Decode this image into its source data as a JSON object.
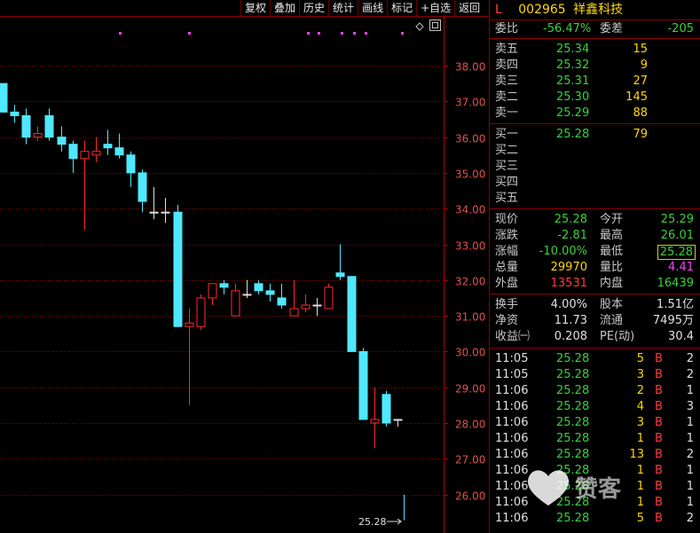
{
  "toolbar": {
    "items": [
      "复权",
      "叠加",
      "历史",
      "统计",
      "画线",
      "标记",
      "+自选",
      "返回"
    ]
  },
  "chart_data": {
    "type": "candlestick",
    "y_ticks": [
      "38.00",
      "37.00",
      "36.00",
      "35.00",
      "34.00",
      "33.00",
      "32.00",
      "31.00",
      "30.00",
      "29.00",
      "28.00",
      "27.00",
      "26.00"
    ],
    "ylim": [
      25.0,
      39.0
    ],
    "price_tag": "25.28",
    "colors": {
      "up": "#ff2a2a",
      "down": "#4fe8ff",
      "grid": "#8b0000",
      "axis": "#b00000",
      "tick_label": "#e05050",
      "flat": "#e0e0e0",
      "marker": "#ff40ff"
    },
    "candles": [
      {
        "o": 37.5,
        "h": 37.5,
        "l": 36.7,
        "c": 36.7
      },
      {
        "o": 36.7,
        "h": 36.9,
        "l": 36.4,
        "c": 36.6
      },
      {
        "o": 36.6,
        "h": 36.8,
        "l": 35.8,
        "c": 36.0
      },
      {
        "o": 36.0,
        "h": 36.3,
        "l": 35.9,
        "c": 36.1
      },
      {
        "o": 36.6,
        "h": 36.8,
        "l": 35.9,
        "c": 36.0
      },
      {
        "o": 36.0,
        "h": 36.3,
        "l": 35.6,
        "c": 35.8
      },
      {
        "o": 35.8,
        "h": 35.9,
        "l": 35.0,
        "c": 35.4
      },
      {
        "o": 35.4,
        "h": 35.9,
        "l": 33.4,
        "c": 35.6
      },
      {
        "o": 35.5,
        "h": 36.0,
        "l": 35.3,
        "c": 35.6
      },
      {
        "o": 35.8,
        "h": 36.2,
        "l": 35.5,
        "c": 35.7
      },
      {
        "o": 35.7,
        "h": 36.1,
        "l": 35.4,
        "c": 35.5
      },
      {
        "o": 35.5,
        "h": 35.6,
        "l": 34.6,
        "c": 35.0
      },
      {
        "o": 35.0,
        "h": 35.1,
        "l": 33.9,
        "c": 34.2
      },
      {
        "o": 33.9,
        "h": 34.6,
        "l": 33.7,
        "c": 33.9
      },
      {
        "o": 33.9,
        "h": 34.3,
        "l": 33.6,
        "c": 33.9
      },
      {
        "o": 33.9,
        "h": 34.1,
        "l": 30.7,
        "c": 30.7
      },
      {
        "o": 30.7,
        "h": 31.2,
        "l": 28.5,
        "c": 30.8
      },
      {
        "o": 30.7,
        "h": 31.6,
        "l": 30.6,
        "c": 31.5
      },
      {
        "o": 31.5,
        "h": 31.9,
        "l": 31.3,
        "c": 31.9
      },
      {
        "o": 31.9,
        "h": 32.0,
        "l": 31.6,
        "c": 31.8
      },
      {
        "o": 31.0,
        "h": 31.9,
        "l": 31.0,
        "c": 31.7
      },
      {
        "o": 31.6,
        "h": 32.0,
        "l": 31.5,
        "c": 31.6
      },
      {
        "o": 31.9,
        "h": 32.0,
        "l": 31.6,
        "c": 31.7
      },
      {
        "o": 31.7,
        "h": 31.9,
        "l": 31.4,
        "c": 31.6
      },
      {
        "o": 31.5,
        "h": 31.9,
        "l": 31.2,
        "c": 31.3
      },
      {
        "o": 31.0,
        "h": 32.0,
        "l": 31.0,
        "c": 31.2
      },
      {
        "o": 31.2,
        "h": 31.6,
        "l": 31.1,
        "c": 31.3
      },
      {
        "o": 31.3,
        "h": 31.5,
        "l": 31.0,
        "c": 31.3
      },
      {
        "o": 31.2,
        "h": 31.9,
        "l": 31.2,
        "c": 31.8
      },
      {
        "o": 32.2,
        "h": 33.0,
        "l": 32.0,
        "c": 32.1
      },
      {
        "o": 32.1,
        "h": 32.1,
        "l": 30.0,
        "c": 30.0
      },
      {
        "o": 30.0,
        "h": 30.1,
        "l": 28.1,
        "c": 28.1
      },
      {
        "o": 28.0,
        "h": 29.0,
        "l": 27.3,
        "c": 28.1
      },
      {
        "o": 28.8,
        "h": 28.9,
        "l": 27.9,
        "c": 28.0
      },
      {
        "o": 28.1,
        "h": 28.1,
        "l": 27.9,
        "c": 28.1
      }
    ],
    "last_bar": {
      "h": 26.0,
      "l": 25.28
    }
  },
  "quote": {
    "L": "L",
    "code": "002965",
    "name": "祥鑫科技",
    "weibi_label": "委比",
    "weibi": "-56.47%",
    "weicha_label": "委差",
    "weicha": "-205",
    "asks": [
      {
        "label": "卖五",
        "price": "25.34",
        "vol": "15"
      },
      {
        "label": "卖四",
        "price": "25.32",
        "vol": "9"
      },
      {
        "label": "卖三",
        "price": "25.31",
        "vol": "27"
      },
      {
        "label": "卖二",
        "price": "25.30",
        "vol": "145"
      },
      {
        "label": "卖一",
        "price": "25.29",
        "vol": "88"
      }
    ],
    "bids": [
      {
        "label": "买一",
        "price": "25.28",
        "vol": "79"
      },
      {
        "label": "买二",
        "price": "",
        "vol": ""
      },
      {
        "label": "买三",
        "price": "",
        "vol": ""
      },
      {
        "label": "买四",
        "price": "",
        "vol": ""
      },
      {
        "label": "买五",
        "price": "",
        "vol": ""
      }
    ],
    "stats": [
      {
        "l1": "现价",
        "v1": "25.28",
        "c1": "g",
        "l2": "今开",
        "v2": "25.29",
        "c2": "g"
      },
      {
        "l1": "涨跌",
        "v1": "-2.81",
        "c1": "g",
        "l2": "最高",
        "v2": "26.01",
        "c2": "g"
      },
      {
        "l1": "涨幅",
        "v1": "-10.00%",
        "c1": "g",
        "l2": "最低",
        "v2": "25.28",
        "c2": "g",
        "box2": true
      },
      {
        "l1": "总量",
        "v1": "29970",
        "c1": "y",
        "l2": "量比",
        "v2": "4.41",
        "c2": "m"
      },
      {
        "l1": "外盘",
        "v1": "13531",
        "c1": "r",
        "l2": "内盘",
        "v2": "16439",
        "c2": "g"
      }
    ],
    "stats2": [
      {
        "l1": "换手",
        "v1": "4.00%",
        "l2": "股本",
        "v2": "1.51亿"
      },
      {
        "l1": "净资",
        "v1": "11.73",
        "l2": "流通",
        "v2": "7495万"
      },
      {
        "l1": "收益㈠",
        "v1": "0.208",
        "l2": "PE(动)",
        "v2": "30.4"
      }
    ],
    "ticks": [
      {
        "t": "11:05",
        "p": "25.28",
        "v": "5",
        "bs": "B",
        "n": "2"
      },
      {
        "t": "11:05",
        "p": "25.28",
        "v": "3",
        "bs": "B",
        "n": "2"
      },
      {
        "t": "11:06",
        "p": "25.28",
        "v": "2",
        "bs": "B",
        "n": "1"
      },
      {
        "t": "11:06",
        "p": "25.28",
        "v": "4",
        "bs": "B",
        "n": "3"
      },
      {
        "t": "11:06",
        "p": "25.28",
        "v": "3",
        "bs": "B",
        "n": "1"
      },
      {
        "t": "11:06",
        "p": "25.28",
        "v": "1",
        "bs": "B",
        "n": "1"
      },
      {
        "t": "11:06",
        "p": "25.28",
        "v": "13",
        "bs": "B",
        "n": "2"
      },
      {
        "t": "11:06",
        "p": "25.28",
        "v": "1",
        "bs": "B",
        "n": "1"
      },
      {
        "t": "11:06",
        "p": "25.28",
        "v": "1",
        "bs": "B",
        "n": "1"
      },
      {
        "t": "11:06",
        "p": "25.28",
        "v": "1",
        "bs": "B",
        "n": "1"
      },
      {
        "t": "11:06",
        "p": "25.28",
        "v": "5",
        "bs": "B",
        "n": "2"
      }
    ]
  },
  "watermark": {
    "logo": "赞客"
  }
}
